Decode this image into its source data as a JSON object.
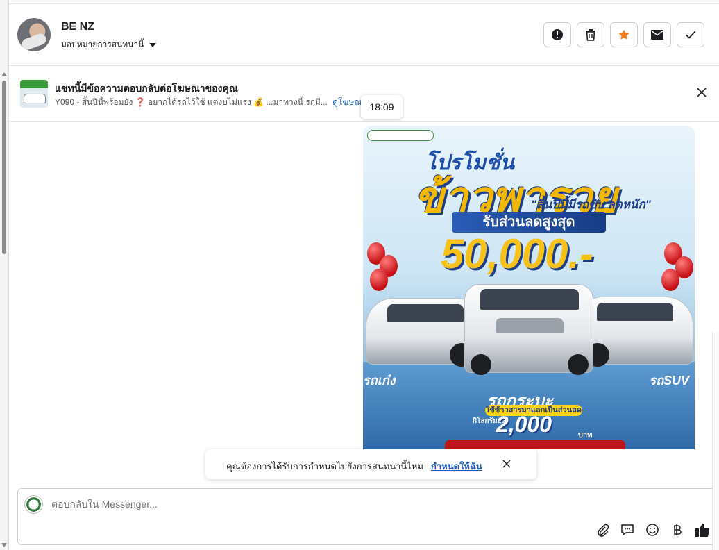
{
  "header": {
    "user_name": "BE NZ",
    "assign_label": "มอบหมายการสนทนานี้",
    "actions": [
      "report-icon",
      "trash-icon",
      "star-icon",
      "mail-icon",
      "check-icon"
    ],
    "star_color": "#f07c1a"
  },
  "ad_banner": {
    "title": "แชทนี้มีข้อความตอบกลับต่อโฆษณาของคุณ",
    "text": "Y090 - สิ้นปีนี้พร้อมยัง ❓ อยากได้รถไว้ใช้ แต่งบไม่แรง 💰 ...มาทางนี้ รถมี...",
    "link": "ดูโฆษณา"
  },
  "timestamp": "18:09",
  "promo_image": {
    "subtitle": "โปรโมชั่น",
    "title": "ข้าวพารวย",
    "tagline": "\"สิ้นปีนี้มีรถขับ ลดหนัก\"",
    "ribbon": "รับส่วนลดสูงสุด",
    "amount": "50,000.-",
    "left_label": "รถเก๋ง",
    "right_label": "รถSUV",
    "middle_label": "รถกระบะ",
    "rice_note": "ใช้ข้าวสารมาแลกเป็นส่วนลด",
    "km_prefix": "กิโลกรัมละ",
    "km_value": "2,000",
    "km_unit": "บาท"
  },
  "toast": {
    "text": "คุณต้องการได้รับการกำหนดไปยังการสนทนานี้ไหม",
    "link": "กำหนดให้ฉัน"
  },
  "composer": {
    "placeholder": "ตอบกลับใน Messenger...",
    "tools": [
      "attachment-icon",
      "saved-reply-icon",
      "emoji-icon",
      "baht-icon",
      "thumbs-up-icon"
    ]
  }
}
